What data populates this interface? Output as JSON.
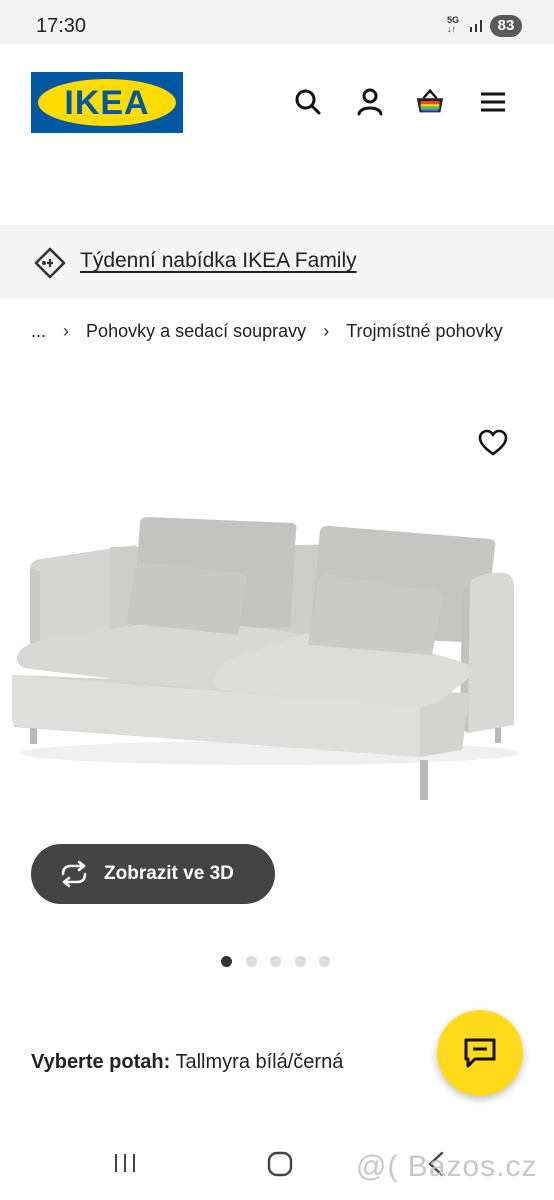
{
  "status_bar": {
    "time": "17:30",
    "network": "5G",
    "battery": "83"
  },
  "header": {
    "logo_text": "IKEA",
    "brand_colors": {
      "blue": "#0058a3",
      "yellow": "#ffdb00"
    },
    "icons": [
      "search-icon",
      "account-icon",
      "basket-icon",
      "menu-icon"
    ]
  },
  "promo": {
    "icon": "tag-icon",
    "text": "Týdenní nabídka IKEA Family"
  },
  "breadcrumb": {
    "ellipsis": "...",
    "items": [
      "Pohovky a sedací soupravy",
      "Trojmístné pohovky"
    ]
  },
  "product": {
    "favorite_icon": "heart-icon",
    "view_3d_label": "Zobrazit ve 3D",
    "carousel": {
      "total": 5,
      "active": 1
    },
    "cover_label": "Vyberte potah:",
    "cover_value": "Tallmyra bílá/černá"
  },
  "chat": {
    "icon": "chat-icon",
    "color": "#ffda1a"
  },
  "watermark": "@( Bazos.cz",
  "android_nav": [
    "recent-apps-icon",
    "home-icon",
    "back-icon"
  ]
}
